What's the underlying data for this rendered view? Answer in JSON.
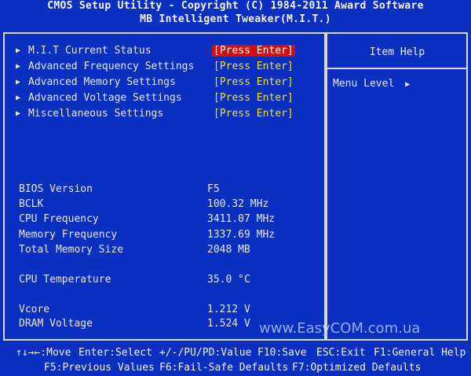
{
  "header": {
    "line1": "CMOS Setup Utility - Copyright (C) 1984-2011 Award Software",
    "line2": "MB Intelligent Tweaker(M.I.T.)"
  },
  "menu": [
    {
      "label": "M.I.T Current Status",
      "action": "[Press Enter]",
      "selected": true
    },
    {
      "label": "Advanced Frequency Settings",
      "action": "[Press Enter]"
    },
    {
      "label": "Advanced Memory Settings",
      "action": "[Press Enter]"
    },
    {
      "label": "Advanced Voltage Settings",
      "action": "[Press Enter]"
    },
    {
      "label": "Miscellaneous Settings",
      "action": "[Press Enter]"
    }
  ],
  "info": [
    {
      "label": "BIOS Version",
      "value": "F5"
    },
    {
      "label": "BCLK",
      "value": "100.32 MHz"
    },
    {
      "label": "CPU Frequency",
      "value": "3411.07 MHz"
    },
    {
      "label": "Memory Frequency",
      "value": "1337.69 MHz"
    },
    {
      "label": "Total Memory Size",
      "value": "2048 MB"
    },
    {
      "label": "CPU Temperature",
      "value": "35.0 °C"
    },
    {
      "label": "Vcore",
      "value": "1.212 V"
    },
    {
      "label": "DRAM Voltage",
      "value": "1.524 V"
    }
  ],
  "help": {
    "title": "Item Help",
    "menu_level": "Menu Level",
    "menu_level_arrow": "▶"
  },
  "watermark": "www.EasyCOM.com.ua",
  "footer": {
    "row1": [
      "↑↓→←:Move",
      "Enter:Select",
      "+/-/PU/PD:Value",
      "F10:Save",
      "ESC:Exit",
      "F1:General Help"
    ],
    "row2": [
      "F5:Previous Values",
      "F6:Fail-Safe Defaults",
      "F7:Optimized Defaults"
    ]
  }
}
